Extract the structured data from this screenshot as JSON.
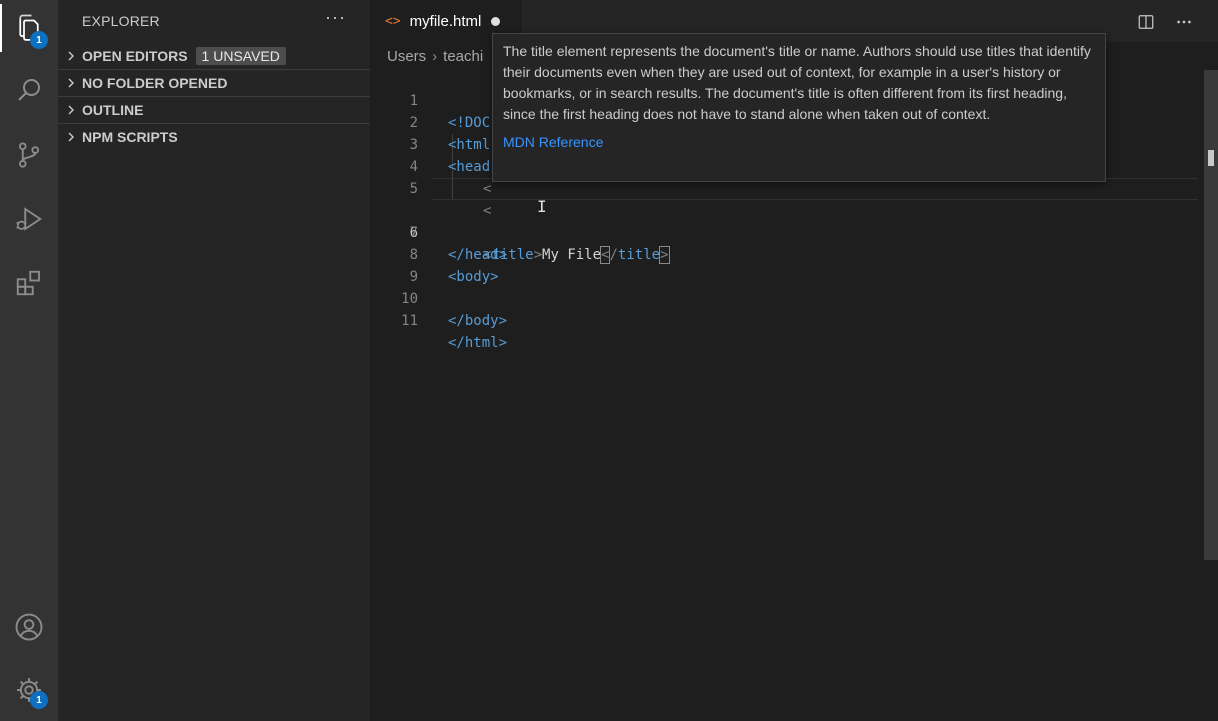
{
  "activity_bar": {
    "items": [
      {
        "icon": "files-icon",
        "badge": "1"
      },
      {
        "icon": "search-icon"
      },
      {
        "icon": "source-control-icon"
      },
      {
        "icon": "run-debug-icon"
      },
      {
        "icon": "extensions-icon"
      }
    ],
    "bottom": [
      {
        "icon": "account-icon"
      },
      {
        "icon": "gear-icon",
        "badge": "1"
      }
    ]
  },
  "sidebar": {
    "title": "EXPLORER",
    "more": "···",
    "sections": [
      {
        "label": "OPEN EDITORS",
        "badge": "1 UNSAVED"
      },
      {
        "label": "NO FOLDER OPENED"
      },
      {
        "label": "OUTLINE"
      },
      {
        "label": "NPM SCRIPTS"
      }
    ]
  },
  "editor": {
    "tab": {
      "icon": "<>",
      "label": "myfile.html",
      "dirty": true
    },
    "breadcrumb": [
      "Users",
      "teachi"
    ],
    "lines": [
      {
        "n": "1",
        "text": "<!DOC"
      },
      {
        "n": "2",
        "text": "<html"
      },
      {
        "n": "3",
        "text": "<head"
      },
      {
        "n": "4",
        "text": "<"
      },
      {
        "n": "5",
        "text": "<"
      },
      {
        "n": "6",
        "open": "title",
        "content": "My File",
        "close": "title"
      },
      {
        "n": "7",
        "text": "</head>"
      },
      {
        "n": "8",
        "text": "<body>"
      },
      {
        "n": "9",
        "text": ""
      },
      {
        "n": "10",
        "text": "</body>"
      },
      {
        "n": "11",
        "text": "</html>"
      }
    ],
    "hover": {
      "text": "The title element represents the document's title or name. Authors should use titles that identify their documents even when they are used out of context, for example in a user's history or bookmarks, or in search results. The document's title is often different from its first heading, since the first heading does not have to stand alone when taken out of context.",
      "link": "MDN Reference"
    },
    "colors": {
      "tag": "#569cd6",
      "punctuation": "#808080",
      "link": "#3794ff",
      "tab_icon": "#e37933"
    }
  }
}
